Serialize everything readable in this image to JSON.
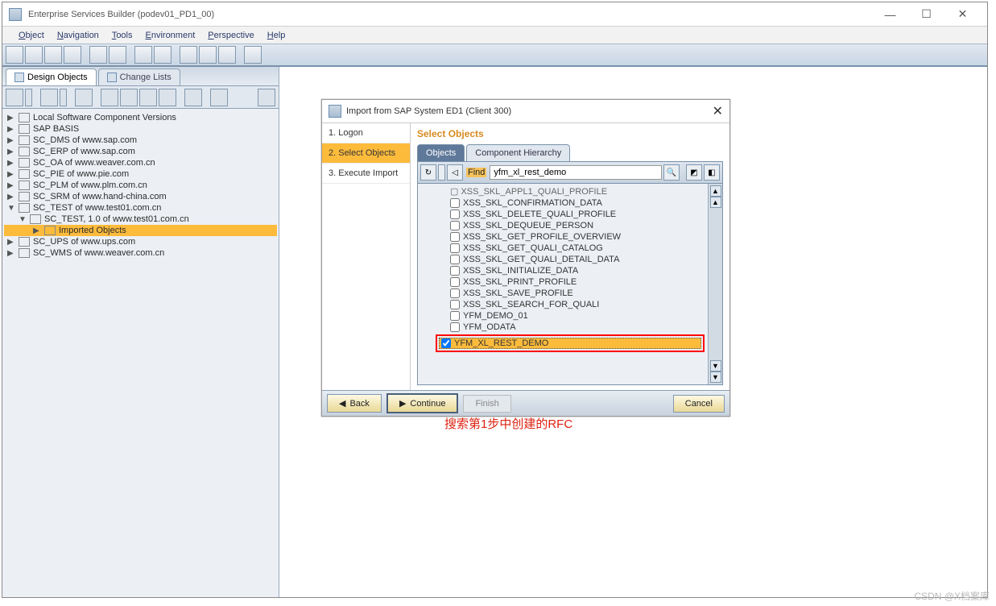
{
  "window": {
    "title": "Enterprise Services Builder (podev01_PD1_00)",
    "min": "—",
    "max": "☐",
    "close": "✕"
  },
  "menubar": [
    "Object",
    "Navigation",
    "Tools",
    "Environment",
    "Perspective",
    "Help"
  ],
  "left": {
    "tabs": {
      "active": "Design Objects",
      "inactive": "Change Lists"
    },
    "tree": [
      {
        "exp": "▶",
        "label": "Local Software Component Versions",
        "indent": 0
      },
      {
        "exp": "▶",
        "label": "SAP BASIS",
        "indent": 0
      },
      {
        "exp": "▶",
        "label": "SC_DMS of www.sap.com",
        "indent": 0
      },
      {
        "exp": "▶",
        "label": "SC_ERP of www.sap.com",
        "indent": 0
      },
      {
        "exp": "▶",
        "label": "SC_OA of www.weaver.com.cn",
        "indent": 0
      },
      {
        "exp": "▶",
        "label": "SC_PIE of www.pie.com",
        "indent": 0
      },
      {
        "exp": "▶",
        "label": "SC_PLM of www.plm.com.cn",
        "indent": 0
      },
      {
        "exp": "▶",
        "label": "SC_SRM of www.hand-china.com",
        "indent": 0
      },
      {
        "exp": "▼",
        "label": "SC_TEST of www.test01.com.cn",
        "indent": 0
      },
      {
        "exp": "▼",
        "label": "SC_TEST, 1.0 of www.test01.com.cn",
        "indent": 1
      },
      {
        "exp": "▶",
        "label": "Imported Objects",
        "indent": 2,
        "sel": true
      },
      {
        "exp": "▶",
        "label": "SC_UPS of www.ups.com",
        "indent": 0
      },
      {
        "exp": "▶",
        "label": "SC_WMS of www.weaver.com.cn",
        "indent": 0
      }
    ]
  },
  "dialog": {
    "title": "Import from SAP System ED1 (Client 300)",
    "steps": [
      "1. Logon",
      "2. Select Objects",
      "3. Execute Import"
    ],
    "active_step": 1,
    "section_title": "Select Objects",
    "tabs": {
      "active": "Objects",
      "inactive": "Component Hierarchy"
    },
    "find_label": "Find",
    "find_value": "yfm_xl_rest_demo",
    "list_top_cut": "▢ XSS_SKL_APPL1_QUALI_PROFILE",
    "list": [
      "XSS_SKL_CONFIRMATION_DATA",
      "XSS_SKL_DELETE_QUALI_PROFILE",
      "XSS_SKL_DEQUEUE_PERSON",
      "XSS_SKL_GET_PROFILE_OVERVIEW",
      "XSS_SKL_GET_QUALI_CATALOG",
      "XSS_SKL_GET_QUALI_DETAIL_DATA",
      "XSS_SKL_INITIALIZE_DATA",
      "XSS_SKL_PRINT_PROFILE",
      "XSS_SKL_SAVE_PROFILE",
      "XSS_SKL_SEARCH_FOR_QUALI",
      "YFM_DEMO_01",
      "YFM_ODATA"
    ],
    "selected_item": "YFM_XL_REST_DEMO",
    "buttons": {
      "back": "Back",
      "continue": "Continue",
      "finish": "Finish",
      "cancel": "Cancel"
    }
  },
  "caption": "搜索第1步中创建的RFC",
  "watermark": "CSDN @X档案库"
}
